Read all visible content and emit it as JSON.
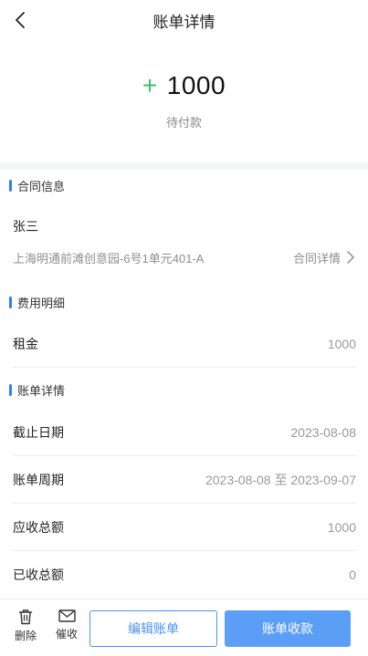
{
  "header": {
    "title": "账单详情",
    "back_icon": "chevron-left-icon"
  },
  "summary": {
    "sign": "+",
    "amount": "1000",
    "status": "待付款"
  },
  "contract": {
    "section_title": "合同信息",
    "tenant": "张三",
    "address": "上海明通前滩创意园-6号1单元401-A",
    "link_label": "合同详情",
    "link_icon": "chevron-right-icon"
  },
  "fees": {
    "section_title": "费用明细",
    "items": [
      {
        "label": "租金",
        "value": "1000"
      }
    ]
  },
  "bill": {
    "section_title": "账单详情",
    "rows": [
      {
        "label": "截止日期",
        "value": "2023-08-08"
      },
      {
        "label": "账单周期",
        "value": "2023-08-08 至 2023-09-07"
      },
      {
        "label": "应收总额",
        "value": "1000"
      },
      {
        "label": "已收总额",
        "value": "0"
      }
    ]
  },
  "footer": {
    "delete_label": "删除",
    "delete_icon": "trash-icon",
    "remind_label": "催收",
    "remind_icon": "envelope-icon",
    "edit_label": "编辑账单",
    "collect_label": "账单收款"
  },
  "colors": {
    "accent": "#2f7cf6",
    "plus": "#3fbf6a",
    "primary_button": "#5b9ef6"
  }
}
